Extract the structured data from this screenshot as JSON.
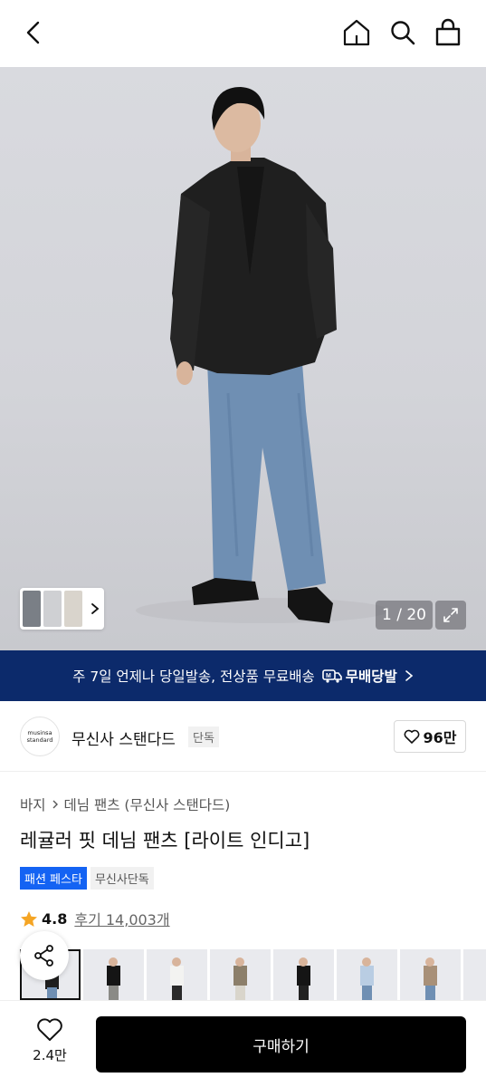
{
  "header": {
    "back_icon": "chevron-left-icon",
    "home_icon": "home-icon",
    "search_icon": "search-icon",
    "cart_icon": "shopping-bag-icon"
  },
  "hero": {
    "counter": "1 / 20",
    "thumb_arrow_icon": "chevron-right-icon",
    "expand_icon": "expand-icon"
  },
  "banner": {
    "text": "주 7일 언제나 당일발송, 전상품 무료배송",
    "badge": "무배당발",
    "badge_icon": "truck-icon"
  },
  "brand": {
    "logo_line1": "musinsa",
    "logo_line2": "standard",
    "name": "무신사 스탠다드",
    "tag": "단독",
    "likes": "96만"
  },
  "breadcrumb": {
    "level1": "바지",
    "level2": "데님 팬츠 (무신사 스탠다드)"
  },
  "product": {
    "title": "레귤러 핏 데님 팬츠 [라이트 인디고]",
    "tag_festa": "패션 페스타",
    "tag_exclusive": "무신사단독",
    "rating": "4.8",
    "reviews": "후기 14,003개"
  },
  "bottom_bar": {
    "wish_count": "2.4만",
    "buy_label": "구매하기"
  },
  "colors": {
    "banner_bg": "#0c2a6b",
    "festa_tag": "#1463f3",
    "star": "#f5a524",
    "buy_button": "#000000"
  }
}
